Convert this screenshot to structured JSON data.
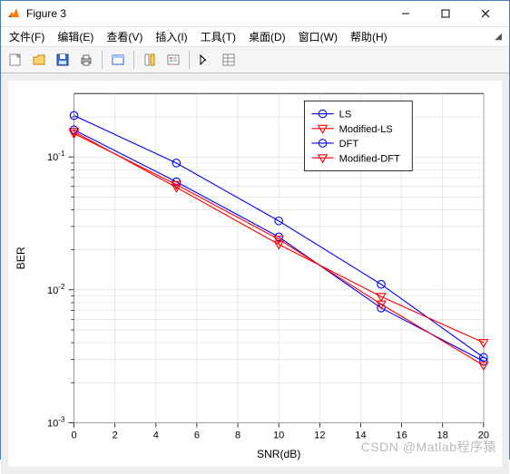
{
  "window": {
    "title": "Figure 3"
  },
  "menu": {
    "file": "文件(F)",
    "edit": "编辑(E)",
    "view": "查看(V)",
    "insert": "插入(I)",
    "tools": "工具(T)",
    "desktop": "桌面(D)",
    "window": "窗口(W)",
    "help": "帮助(H)"
  },
  "watermark": "CSDN @Matlab程序猿",
  "chart_data": {
    "type": "line",
    "xlabel": "SNR(dB)",
    "ylabel": "BER",
    "xlim": [
      0,
      20
    ],
    "ylim": [
      0.001,
      0.3
    ],
    "yscale": "log",
    "xticks": [
      0,
      2,
      4,
      6,
      8,
      10,
      12,
      14,
      16,
      18,
      20
    ],
    "series": [
      {
        "name": "LS",
        "color": "#0000ff",
        "marker": "circle",
        "x": [
          0,
          5,
          10,
          15,
          20
        ],
        "y": [
          0.205,
          0.09,
          0.033,
          0.011,
          0.0031
        ]
      },
      {
        "name": "Modified-LS",
        "color": "#ff0000",
        "marker": "triangle",
        "x": [
          0,
          5,
          10,
          15,
          20
        ],
        "y": [
          0.155,
          0.059,
          0.022,
          0.0089,
          0.004
        ]
      },
      {
        "name": "DFT",
        "color": "#0000ff",
        "marker": "circle",
        "x": [
          0,
          5,
          10,
          15,
          20
        ],
        "y": [
          0.16,
          0.065,
          0.025,
          0.0073,
          0.0029
        ]
      },
      {
        "name": "Modified-DFT",
        "color": "#ff0000",
        "marker": "triangle",
        "x": [
          0,
          5,
          10,
          15,
          20
        ],
        "y": [
          0.15,
          0.062,
          0.024,
          0.0078,
          0.0027
        ]
      }
    ],
    "legend_position": "top-right"
  }
}
